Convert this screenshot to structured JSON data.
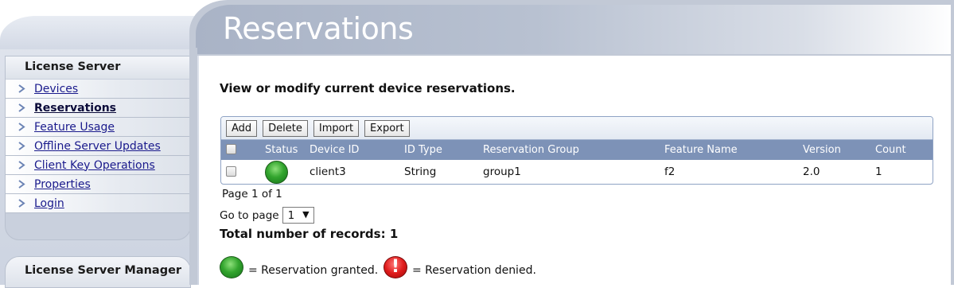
{
  "sidebar": {
    "title": "License Server",
    "items": [
      {
        "label": "Devices"
      },
      {
        "label": "Reservations"
      },
      {
        "label": "Feature Usage"
      },
      {
        "label": "Offline Server Updates"
      },
      {
        "label": "Client Key Operations"
      },
      {
        "label": "Properties"
      },
      {
        "label": "Login"
      }
    ],
    "active": "Reservations",
    "manager_title": "License Server Manager"
  },
  "header": {
    "title": "Reservations"
  },
  "main": {
    "intro": "View or modify current device reservations.",
    "toolbar": {
      "add": "Add",
      "delete": "Delete",
      "import": "Import",
      "export": "Export"
    },
    "table": {
      "columns": [
        "Status",
        "Device ID",
        "ID Type",
        "Reservation Group",
        "Feature Name",
        "Version",
        "Count"
      ],
      "rows": [
        {
          "status": "granted",
          "device_id": "client3",
          "id_type": "String",
          "reservation_group": "group1",
          "feature_name": "f2",
          "version": "2.0",
          "count": "1"
        }
      ]
    },
    "pager": {
      "text": "Page 1 of 1",
      "goto_label": "Go to page",
      "goto_value": "1"
    },
    "total": "Total number of records: 1",
    "legend": {
      "granted": "= Reservation granted.",
      "denied": "= Reservation denied.",
      "denied_symbol": "!"
    }
  },
  "colors": {
    "header_row": "#7d92b7",
    "granted": "#33a52e",
    "denied": "#e01c1c"
  }
}
